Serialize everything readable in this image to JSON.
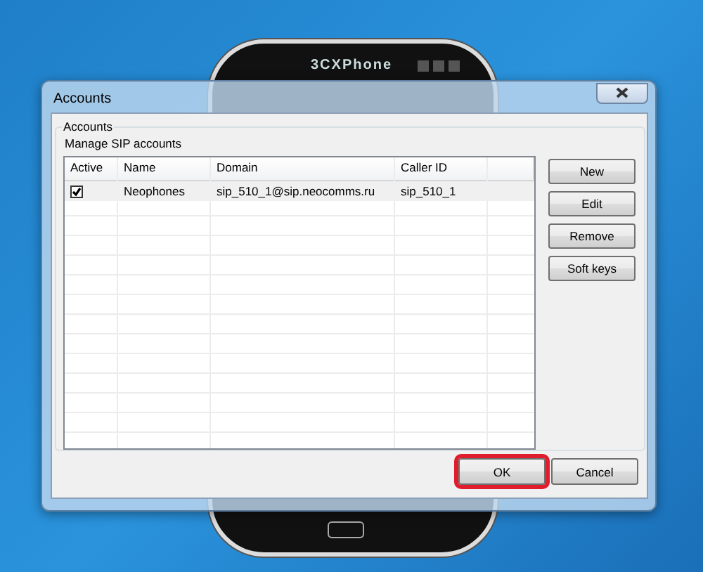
{
  "phone": {
    "title": "3CXPhone"
  },
  "window": {
    "title": "Accounts"
  },
  "group": {
    "title": "Accounts",
    "description": "Manage SIP accounts"
  },
  "table": {
    "columns": [
      "Active",
      "Name",
      "Domain",
      "Caller ID"
    ],
    "rows": [
      {
        "selected": true,
        "cells": [
          {
            "kind": "checkbox",
            "checked": true
          },
          {
            "kind": "text",
            "text": "Neophones"
          },
          {
            "kind": "text",
            "text": "sip_510_1@sip.neocomms.ru"
          },
          {
            "kind": "text",
            "text": "sip_510_1"
          }
        ]
      }
    ]
  },
  "side_buttons": [
    "New",
    "Edit",
    "Remove",
    "Soft keys"
  ],
  "buttons": [
    {
      "label": "OK",
      "highlighted": true
    },
    {
      "label": "Cancel",
      "highlighted": false
    }
  ]
}
